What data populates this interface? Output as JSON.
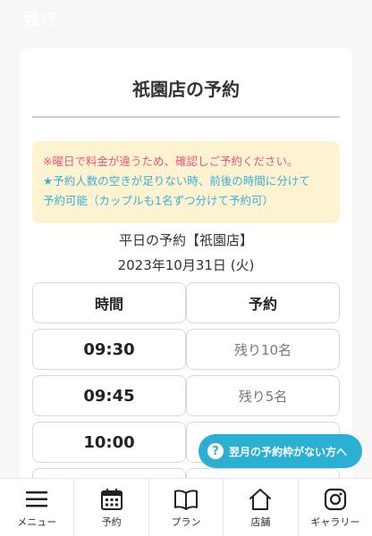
{
  "logo": {
    "line1": "翌行",
    "line2": ""
  },
  "page": {
    "title": "祇園店の予約"
  },
  "notice": {
    "line1": "※曜日で料金が違うため、確認しご予約ください。",
    "line2": "★予約人数の空きが足りない時、前後の時間に分けて",
    "line3": "予約可能（カップルも1名ずつ分けて予約可）"
  },
  "schedule": {
    "weekday_label": "平日の予約【祇園店】",
    "date": "2023年10月31日 (火)",
    "headers": {
      "time": "時間",
      "reservation": "予約"
    },
    "rows": [
      {
        "time": "09:30",
        "remaining": "残り10名"
      },
      {
        "time": "09:45",
        "remaining": "残り5名"
      },
      {
        "time": "10:00",
        "remaining": ""
      }
    ]
  },
  "float_button": {
    "label": "翌月の予約枠がない方へ"
  },
  "nav": {
    "items": [
      {
        "label": "メニュー",
        "icon": "menu-icon"
      },
      {
        "label": "予約",
        "icon": "calendar-icon"
      },
      {
        "label": "プラン",
        "icon": "book-icon"
      },
      {
        "label": "店舗",
        "icon": "home-icon"
      },
      {
        "label": "ギャラリー",
        "icon": "instagram-icon"
      }
    ]
  }
}
